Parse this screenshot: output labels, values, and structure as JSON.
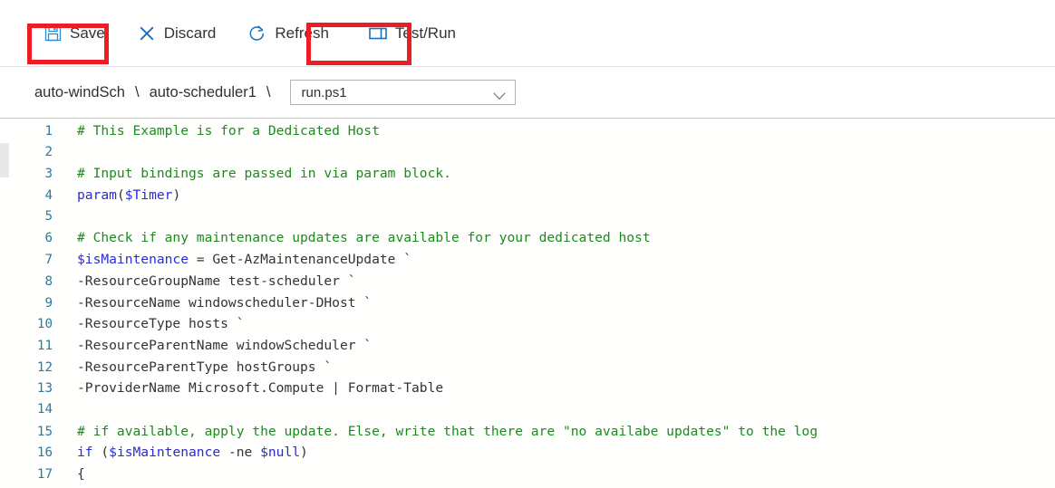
{
  "toolbar": {
    "buttons": [
      {
        "label": "Save",
        "icon": "save-floppy-icon",
        "highlighted": true
      },
      {
        "label": "Discard",
        "icon": "close-x-icon",
        "highlighted": false
      },
      {
        "label": "Refresh",
        "icon": "refresh-circle-icon",
        "highlighted": false
      },
      {
        "label": "Test/Run",
        "icon": "test-run-panel-icon",
        "highlighted": true
      }
    ],
    "highlight_color": "#ee1c25",
    "icon_color": "#0078d4"
  },
  "breadcrumb": {
    "items": [
      "auto-windSch",
      "auto-scheduler1"
    ],
    "separator": "\\",
    "trailing_separator": "\\"
  },
  "file_selector": {
    "value": "run.ps1",
    "chevron": "chevron-down-icon"
  },
  "editor": {
    "language": "powershell",
    "colors": {
      "comment": "#1d8a1d",
      "keyword": "#2b2bd6",
      "variable": "#2b2bd6",
      "plain": "#333333",
      "line_number": "#2b7a9b",
      "background": "#fffffe"
    },
    "lines": [
      {
        "n": "1",
        "tokens": [
          {
            "t": "# This Example is for a Dedicated Host",
            "c": "comment"
          }
        ]
      },
      {
        "n": "2",
        "tokens": []
      },
      {
        "n": "3",
        "tokens": [
          {
            "t": "# Input bindings are passed in via param block.",
            "c": "comment"
          }
        ]
      },
      {
        "n": "4",
        "tokens": [
          {
            "t": "param",
            "c": "keyword"
          },
          {
            "t": "(",
            "c": "plain"
          },
          {
            "t": "$Timer",
            "c": "variable"
          },
          {
            "t": ")",
            "c": "plain"
          }
        ]
      },
      {
        "n": "5",
        "tokens": []
      },
      {
        "n": "6",
        "tokens": [
          {
            "t": "# Check if any maintenance updates are available for your dedicated host",
            "c": "comment"
          }
        ]
      },
      {
        "n": "7",
        "tokens": [
          {
            "t": "$isMaintenance",
            "c": "variable"
          },
          {
            "t": " = Get-AzMaintenanceUpdate `",
            "c": "plain"
          }
        ]
      },
      {
        "n": "8",
        "tokens": [
          {
            "t": "-ResourceGroupName test-scheduler `",
            "c": "plain"
          }
        ]
      },
      {
        "n": "9",
        "tokens": [
          {
            "t": "-ResourceName windowscheduler-DHost `",
            "c": "plain"
          }
        ]
      },
      {
        "n": "10",
        "tokens": [
          {
            "t": "-ResourceType hosts `",
            "c": "plain"
          }
        ]
      },
      {
        "n": "11",
        "tokens": [
          {
            "t": "-ResourceParentName windowScheduler `",
            "c": "plain"
          }
        ]
      },
      {
        "n": "12",
        "tokens": [
          {
            "t": "-ResourceParentType hostGroups `",
            "c": "plain"
          }
        ]
      },
      {
        "n": "13",
        "tokens": [
          {
            "t": "-ProviderName Microsoft.Compute | Format-Table",
            "c": "plain"
          }
        ]
      },
      {
        "n": "14",
        "tokens": []
      },
      {
        "n": "15",
        "tokens": [
          {
            "t": "# if available, apply the update. Else, write that there are \"no availabe updates\" to the log",
            "c": "comment"
          }
        ]
      },
      {
        "n": "16",
        "tokens": [
          {
            "t": "if",
            "c": "keyword"
          },
          {
            "t": " (",
            "c": "plain"
          },
          {
            "t": "$isMaintenance",
            "c": "variable"
          },
          {
            "t": " -ne ",
            "c": "plain"
          },
          {
            "t": "$null",
            "c": "variable"
          },
          {
            "t": ")",
            "c": "plain"
          }
        ]
      },
      {
        "n": "17",
        "tokens": [
          {
            "t": "{",
            "c": "plain"
          }
        ]
      }
    ]
  }
}
